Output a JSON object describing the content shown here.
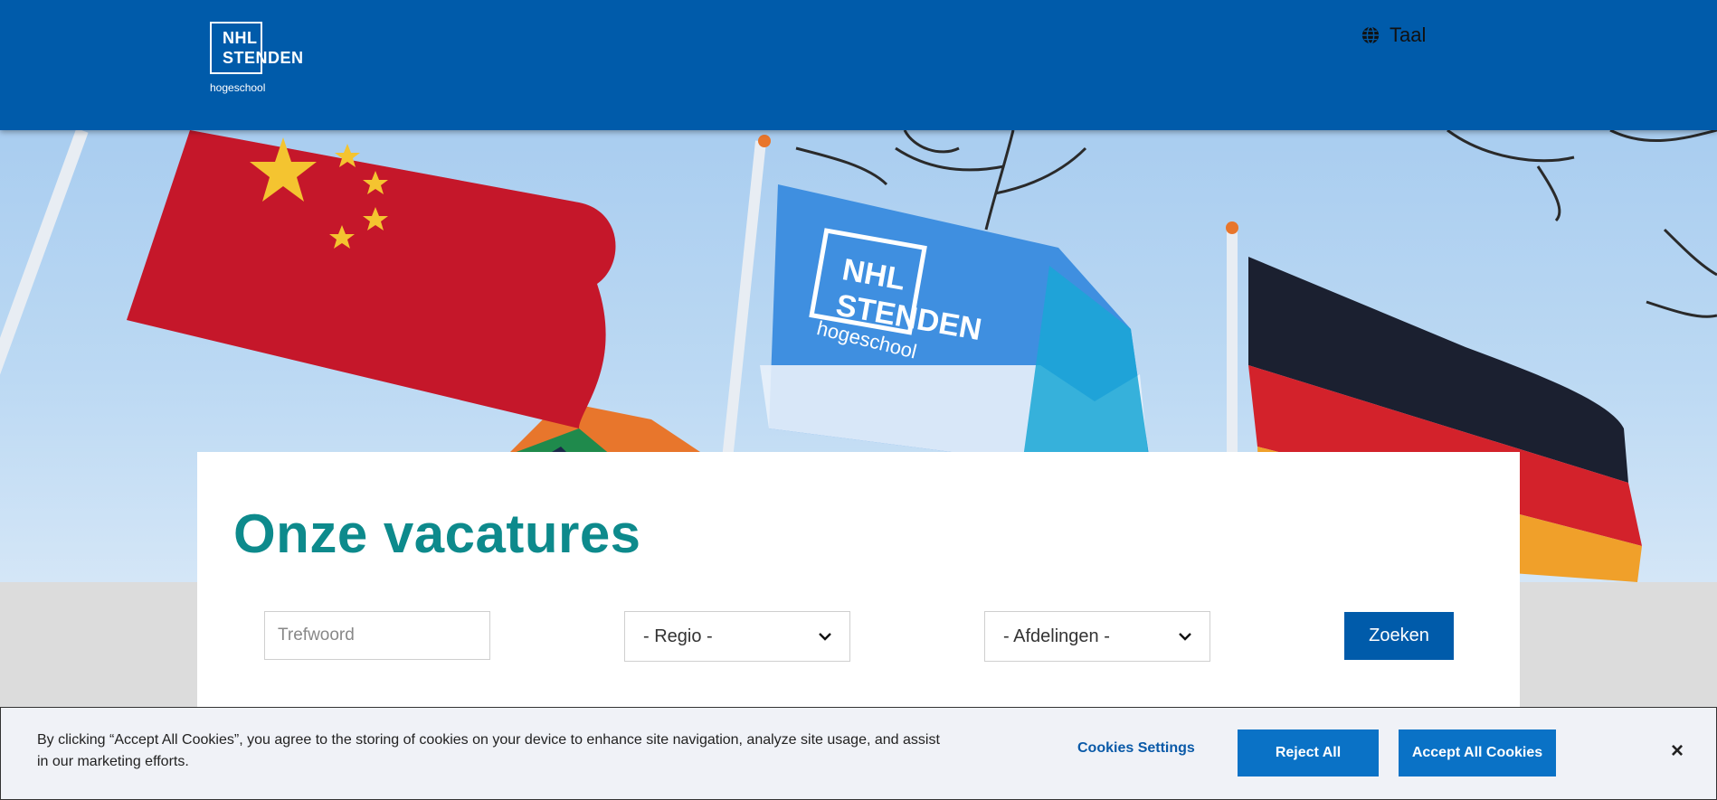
{
  "header": {
    "logo": {
      "line1": "NHL",
      "line2": "STENDEN",
      "line3": "hogeschool"
    },
    "language_label": "Taal",
    "language_icon": "globe-icon"
  },
  "hero": {
    "flag_text_line1": "NHL",
    "flag_text_line2": "STENDEN",
    "flag_text_line3": "hogeschool"
  },
  "main": {
    "title": "Onze vacatures",
    "keyword_placeholder": "Trefwoord",
    "region_selected": "- Regio -",
    "department_selected": "- Afdelingen -",
    "search_label": "Zoeken"
  },
  "cookie": {
    "text": "By clicking “Accept All Cookies”, you agree to the storing of cookies on your device to enhance site navigation, analyze site usage, and assist in our marketing efforts.",
    "settings_label": "Cookies Settings",
    "reject_label": "Reject All",
    "accept_label": "Accept All Cookies",
    "close_label": "×"
  },
  "colors": {
    "header_bg": "#005baa",
    "title_teal": "#0d8a8c",
    "cookie_button": "#0a72c6"
  }
}
